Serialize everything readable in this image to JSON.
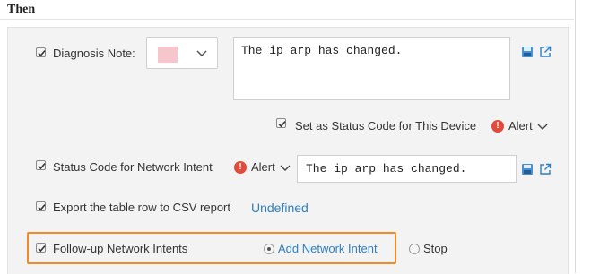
{
  "section": {
    "title": "Then"
  },
  "diagnosis": {
    "label": "Diagnosis Note:",
    "checked": true,
    "color_value": "#f7c6cc",
    "note_text": "The ip arp has changed."
  },
  "status_code_device": {
    "label": "Set as Status Code for This Device",
    "checked": true,
    "level": "Alert"
  },
  "status_code_intent": {
    "label": "Status Code for Network Intent",
    "checked": true,
    "level": "Alert",
    "message": "The ip arp has changed."
  },
  "export": {
    "label": "Export the table row to CSV report",
    "checked": true,
    "link": "Undefined"
  },
  "followup": {
    "label": "Follow-up Network Intents",
    "checked": true,
    "option_add": "Add Network Intent",
    "option_stop": "Stop",
    "selected": "Add Network Intent"
  },
  "icons": {
    "save": "save-icon",
    "open": "external-link-icon",
    "alert": "alert-icon",
    "chevron": "chevron-down-icon"
  },
  "colors": {
    "accent_link": "#2d7fc1",
    "alert_red": "#e24b3b",
    "highlight_orange": "#f08a24"
  }
}
